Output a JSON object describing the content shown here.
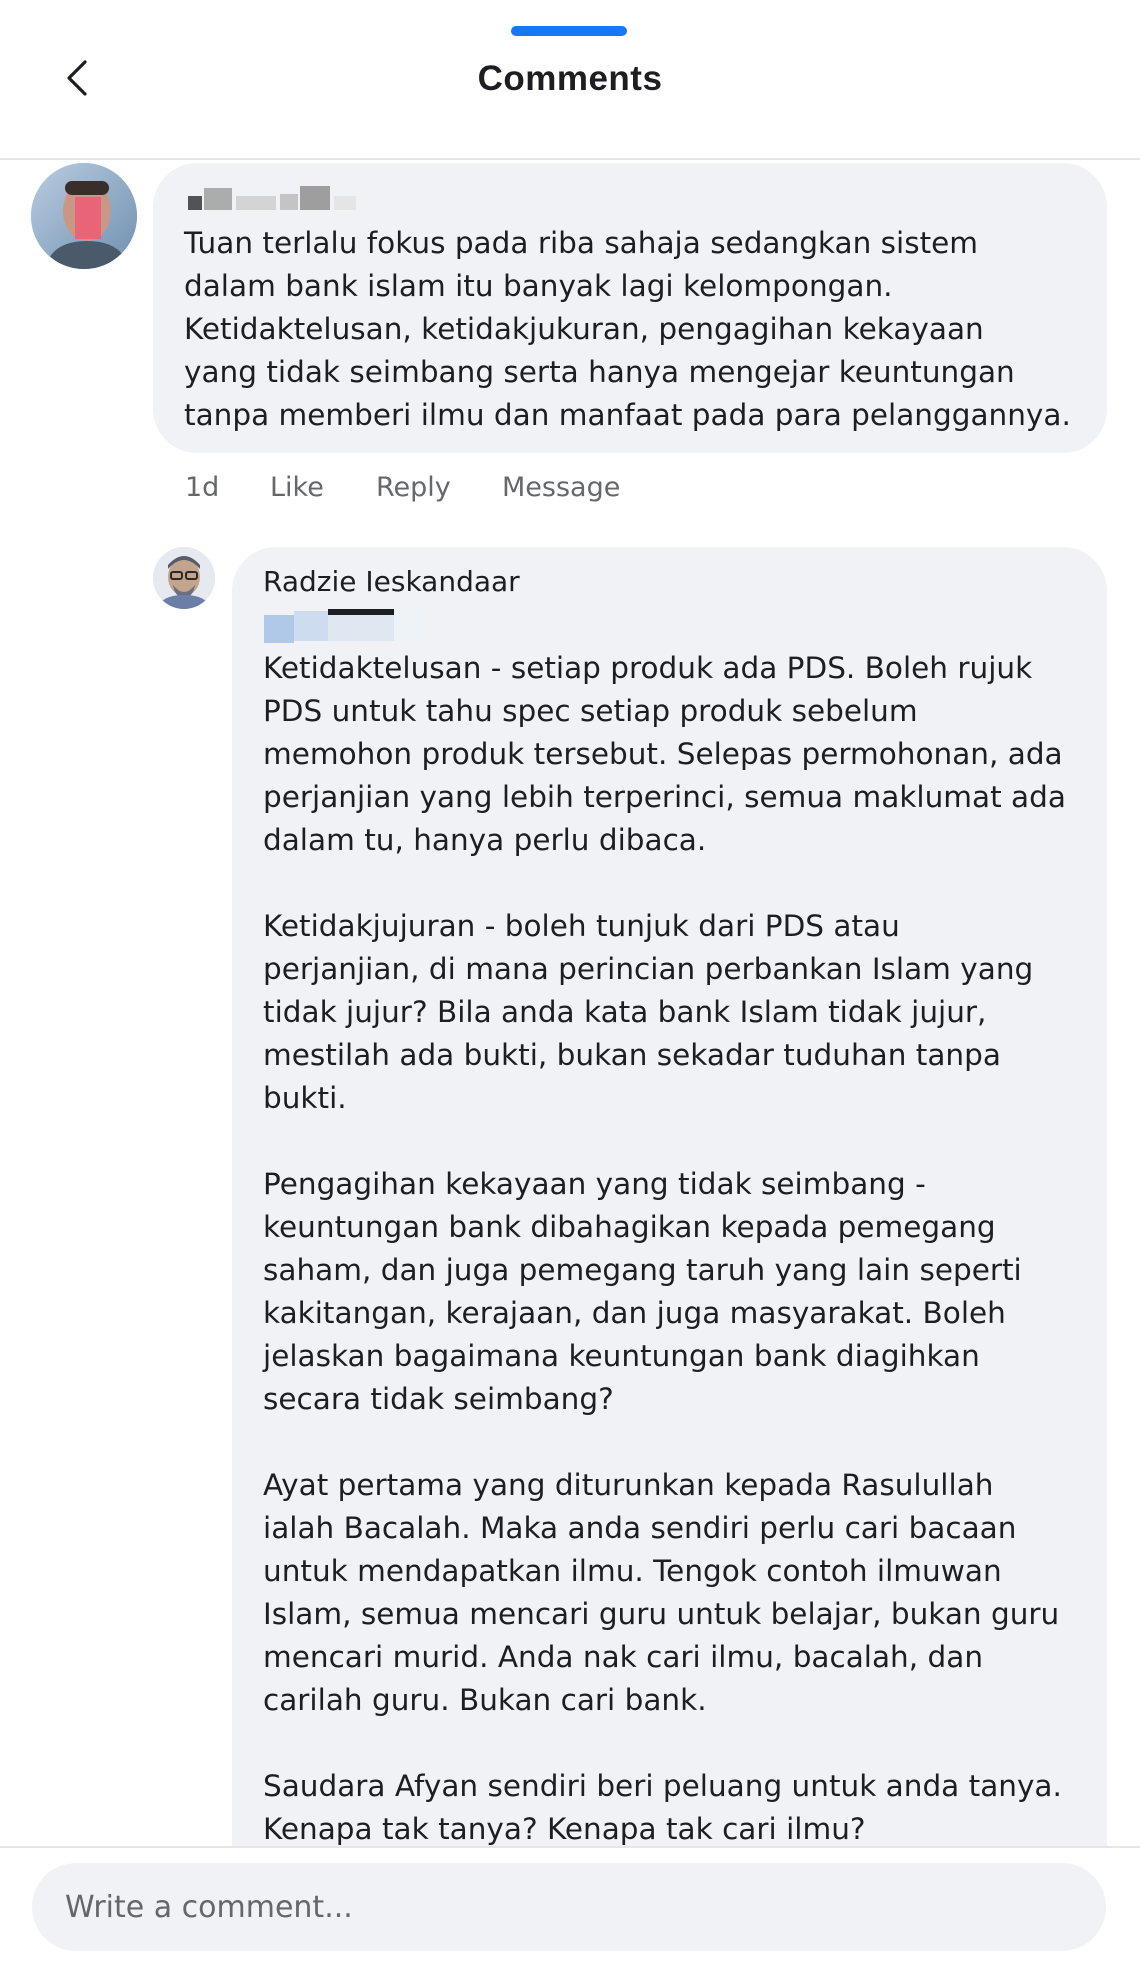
{
  "header": {
    "title": "Comments",
    "back_icon": "chevron-left-icon"
  },
  "comments": [
    {
      "author": "",
      "avatar_icon": "avatar-photo",
      "text": "Tuan terlalu fokus pada riba sahaja sedangkan sistem\ndalam bank islam itu banyak lagi kelompongan.\nKetidaktelusan, ketidakjukuran, pengagihan kekayaan\nyang tidak seimbang serta hanya mengejar keuntungan\ntanpa memberi ilmu dan manfaat pada para pelanggannya.",
      "actions": {
        "time": "1d",
        "like": "Like",
        "reply": "Reply",
        "message": "Message"
      }
    }
  ],
  "reply": {
    "author": "Radzie Ieskandaar",
    "avatar_icon": "avatar-photo",
    "text": "Ketidaktelusan - setiap produk ada PDS. Boleh rujuk\nPDS untuk tahu spec setiap produk sebelum\nmemohon produk tersebut. Selepas permohonan, ada\nperjanjian yang lebih terperinci, semua maklumat ada\ndalam tu, hanya perlu dibaca.\n\nKetidakjujuran - boleh tunjuk dari PDS atau\nperjanjian, di mana perincian perbankan Islam yang\ntidak jujur? Bila anda kata bank Islam tidak jujur,\nmestilah ada bukti, bukan sekadar tuduhan tanpa\nbukti.\n\nPengagihan kekayaan yang tidak seimbang -\nkeuntungan bank dibahagikan kepada pemegang\nsaham, dan juga pemegang taruh yang lain seperti\nkakitangan, kerajaan, dan juga masyarakat. Boleh\njelaskan bagaimana keuntungan bank diagihkan\nsecara tidak seimbang?\n\nAyat pertama yang diturunkan kepada Rasulullah\nialah Bacalah. Maka anda sendiri perlu cari bacaan\nuntuk mendapatkan ilmu. Tengok contoh ilmuwan\nIslam, semua mencari guru untuk belajar, bukan guru\nmencari murid. Anda nak cari ilmu, bacalah, dan\ncarilah guru. Bukan cari bank.\n\nSaudara Afyan sendiri beri peluang untuk anda tanya.\nKenapa tak tanya? Kenapa tak cari ilmu?"
  },
  "composer": {
    "placeholder": "Write a comment..."
  },
  "colors": {
    "accent": "#1877f2",
    "bubble": "#f0f2f5",
    "secondary_text": "#65676b"
  }
}
